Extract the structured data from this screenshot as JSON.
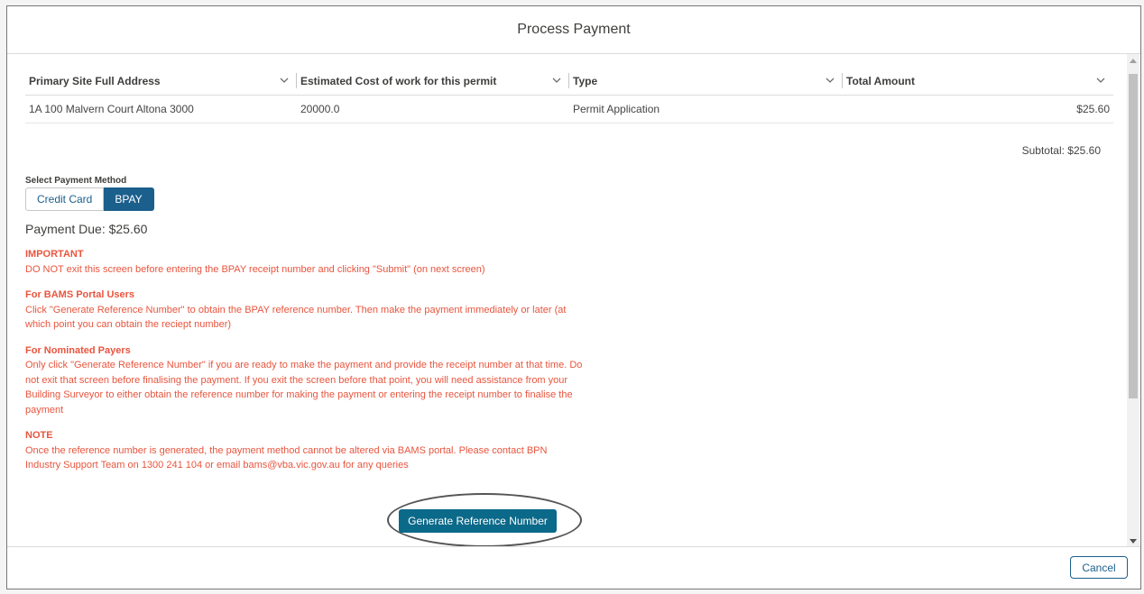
{
  "modal": {
    "title": "Process Payment"
  },
  "table": {
    "columns": [
      "Primary Site Full Address",
      "Estimated Cost of work for this permit",
      "Type",
      "Total Amount"
    ],
    "rows": [
      [
        "1A 100 Malvern Court Altona 3000",
        "20000.0",
        "Permit Application",
        "$25.60"
      ]
    ]
  },
  "subtotal": "Subtotal: $25.60",
  "payment_method": {
    "label": "Select Payment Method",
    "options": [
      "Credit Card",
      "BPAY"
    ],
    "selected": "BPAY"
  },
  "payment_due": "Payment Due: $25.60",
  "notices": [
    {
      "heading": "IMPORTANT",
      "text": "DO NOT exit this screen before entering the BPAY receipt number and clicking \"Submit\" (on next screen)"
    },
    {
      "heading": "For BAMS Portal Users",
      "text": "Click \"Generate Reference Number\" to obtain the BPAY reference number. Then make the payment immediately or later (at which point you can obtain the reciept number)"
    },
    {
      "heading": "For Nominated Payers",
      "text": "Only click \"Generate Reference Number\" if you are ready to make the payment and provide the receipt number at that time. Do not exit that screen before finalising the payment. If you exit the screen before that point, you will need assistance from your Building Surveyor to either obtain the reference number for making the payment or entering the receipt number to finalise the payment"
    },
    {
      "heading": "NOTE",
      "text": "Once the reference number is generated, the payment method cannot be altered via BAMS portal. Please contact BPN Industry Support Team on 1300 241 104 or email bams@vba.vic.gov.au for any queries"
    }
  ],
  "generate_button": "Generate Reference Number",
  "footer": {
    "cancel_label": "Cancel"
  },
  "colors": {
    "accent": "#1b5f8c",
    "generate_button": "#0b6989",
    "notice_text": "#e8553e"
  }
}
